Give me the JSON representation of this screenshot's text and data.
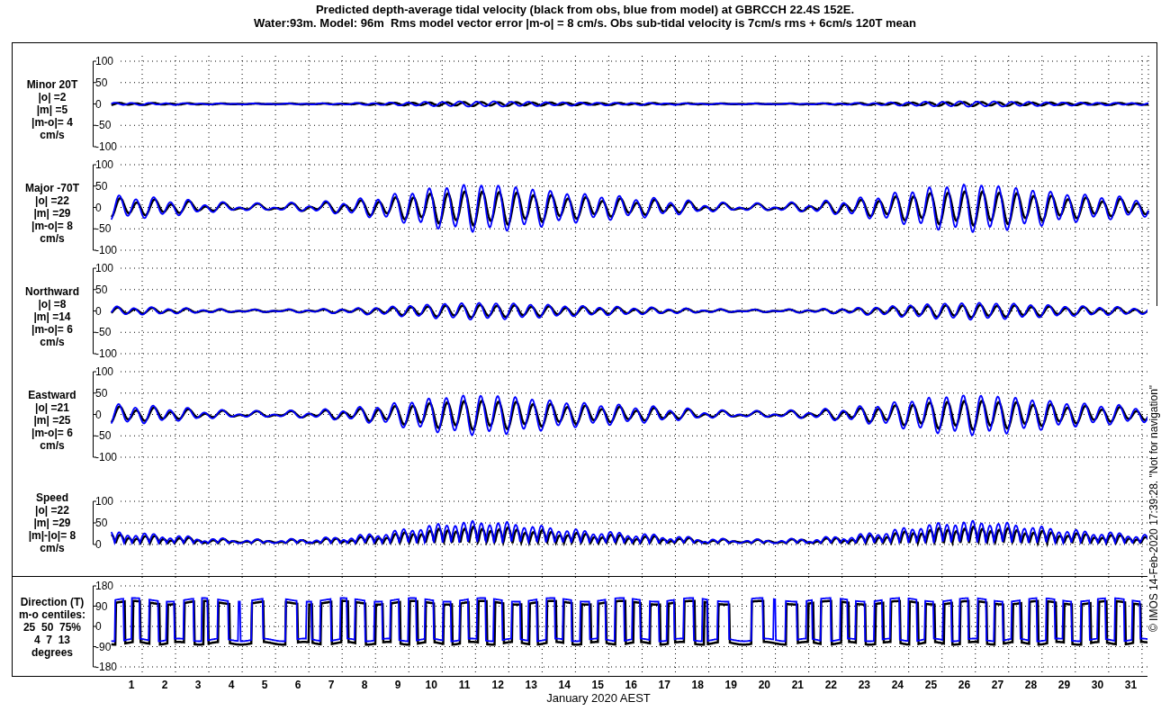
{
  "title_lines": [
    "Predicted depth-average tidal velocity (black from obs, blue from model) at GBRCCH 22.4S 152E.",
    "Water:93m. Model: 96m  Rms model vector error |m-o| = 8 cm/s. Obs sub-tidal velocity is 7cm/s rms + 6cm/s 120T mean"
  ],
  "panels": [
    {
      "kind": "velocity",
      "label_lines": [
        "Minor 20T",
        "|o| =2",
        "|m| =5",
        "|m-o|= 4",
        "cm/s"
      ],
      "yticks": [
        "100",
        "50",
        "0",
        "-50",
        "-100"
      ],
      "traces": [
        {
          "color": "#000000"
        },
        {
          "color": "#0000ff"
        }
      ]
    },
    {
      "kind": "velocity",
      "label_lines": [
        "Major -70T",
        "|o| =22",
        "|m| =29",
        "|m-o|= 8",
        "cm/s"
      ],
      "yticks": [
        "100",
        "50",
        "0",
        "-50",
        "-100"
      ],
      "traces": [
        {
          "color": "#000000"
        },
        {
          "color": "#0000ff"
        }
      ]
    },
    {
      "kind": "velocity",
      "label_lines": [
        "Northward",
        "|o| =8",
        "|m| =14",
        "|m-o|= 6",
        "cm/s"
      ],
      "yticks": [
        "100",
        "50",
        "0",
        "-50",
        "-100"
      ],
      "traces": [
        {
          "color": "#000000"
        },
        {
          "color": "#0000ff"
        }
      ]
    },
    {
      "kind": "velocity",
      "label_lines": [
        "Eastward",
        "|o| =21",
        "|m| =25",
        "|m-o|= 6",
        "cm/s"
      ],
      "yticks": [
        "100",
        "50",
        "0",
        "-50",
        "-100"
      ],
      "traces": [
        {
          "color": "#000000"
        },
        {
          "color": "#0000ff"
        }
      ]
    },
    {
      "kind": "speed",
      "label_lines": [
        "Speed",
        "|o| =22",
        "|m| =29",
        "|m|-|o|= 8",
        "cm/s"
      ],
      "yticks": [
        "100",
        "50",
        "0"
      ],
      "traces": [
        {
          "color": "#000000"
        },
        {
          "color": "#0000ff"
        }
      ]
    },
    {
      "kind": "direction",
      "label_lines": [
        "Direction (T)",
        "m-o centiles:",
        "25  50  75%",
        "4  7  13",
        "degrees"
      ],
      "yticks": [
        "180",
        "90",
        "0",
        "-90",
        "-180"
      ],
      "traces": [
        {
          "color": "#000000"
        },
        {
          "color": "#0000ff"
        }
      ]
    }
  ],
  "day_labels": [
    "1",
    "2",
    "3",
    "4",
    "5",
    "6",
    "7",
    "8",
    "9",
    "10",
    "11",
    "12",
    "13",
    "14",
    "15",
    "16",
    "17",
    "18",
    "19",
    "20",
    "21",
    "22",
    "23",
    "24",
    "25",
    "26",
    "27",
    "28",
    "29",
    "30",
    "31"
  ],
  "xlabel": "January 2020 AEST",
  "stamp": "© IMOS 14-Feb-2020 17:39:28. \"Not for navigation\""
}
